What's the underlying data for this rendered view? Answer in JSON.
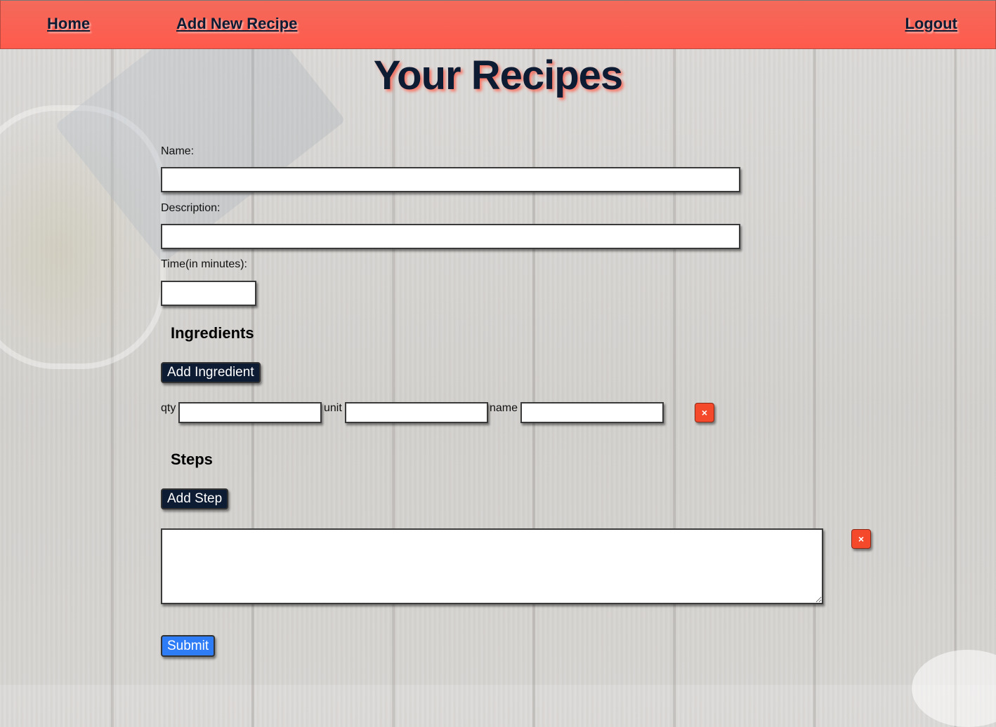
{
  "nav": {
    "home": "Home",
    "add_new": "Add New Recipe",
    "logout": "Logout"
  },
  "page_title": "Your Recipes",
  "form": {
    "name_label": "Name:",
    "name_value": "",
    "description_label": "Description:",
    "description_value": "",
    "time_label": "Time(in minutes):",
    "time_value": "",
    "ingredients_heading": "Ingredients",
    "add_ingredient_label": "Add Ingredient",
    "ingredient_row": {
      "qty_label": "qty",
      "unit_label": "unit",
      "name_label": "name",
      "qty_value": "",
      "unit_value": "",
      "name_value": "",
      "remove_label": "×"
    },
    "steps_heading": "Steps",
    "add_step_label": "Add Step",
    "step_row": {
      "value": "",
      "remove_label": "×"
    },
    "submit_label": "Submit"
  },
  "colors": {
    "nav_bg": "#ff5a4c",
    "navy": "#0d1b33",
    "remove_red": "#f44a2b",
    "submit_blue": "#2e7cf6"
  }
}
